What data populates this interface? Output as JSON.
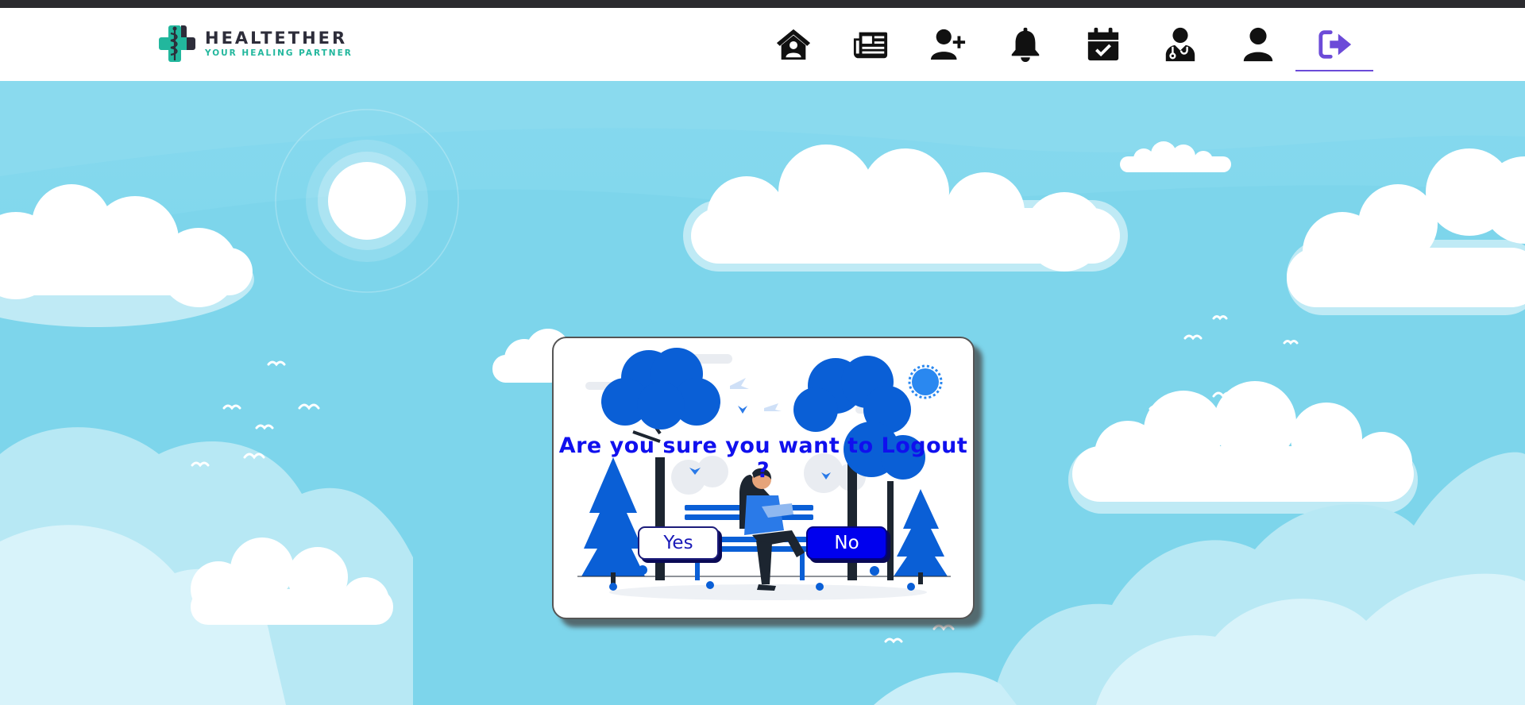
{
  "brand": {
    "name": "HEALTETHER",
    "tagline": "YOUR HEALING PARTNER",
    "colors": {
      "primary_text": "#2d2d3a",
      "accent": "#22b79d",
      "nav_active": "#6c4bd8"
    }
  },
  "nav": {
    "items": [
      {
        "id": "home",
        "icon": "home-user-icon"
      },
      {
        "id": "news",
        "icon": "newspaper-icon"
      },
      {
        "id": "add-user",
        "icon": "user-plus-icon"
      },
      {
        "id": "notifications",
        "icon": "bell-icon"
      },
      {
        "id": "appointments",
        "icon": "calendar-check-icon"
      },
      {
        "id": "doctor",
        "icon": "doctor-icon"
      },
      {
        "id": "profile",
        "icon": "user-icon"
      },
      {
        "id": "logout",
        "icon": "sign-out-icon",
        "active": true
      }
    ]
  },
  "dialog": {
    "message": "Are you sure you want to Logout ?",
    "yes_label": "Yes",
    "no_label": "No",
    "colors": {
      "message": "#1010ee",
      "no_bg": "#0000ee",
      "illustration": "#0a5fd6"
    }
  }
}
